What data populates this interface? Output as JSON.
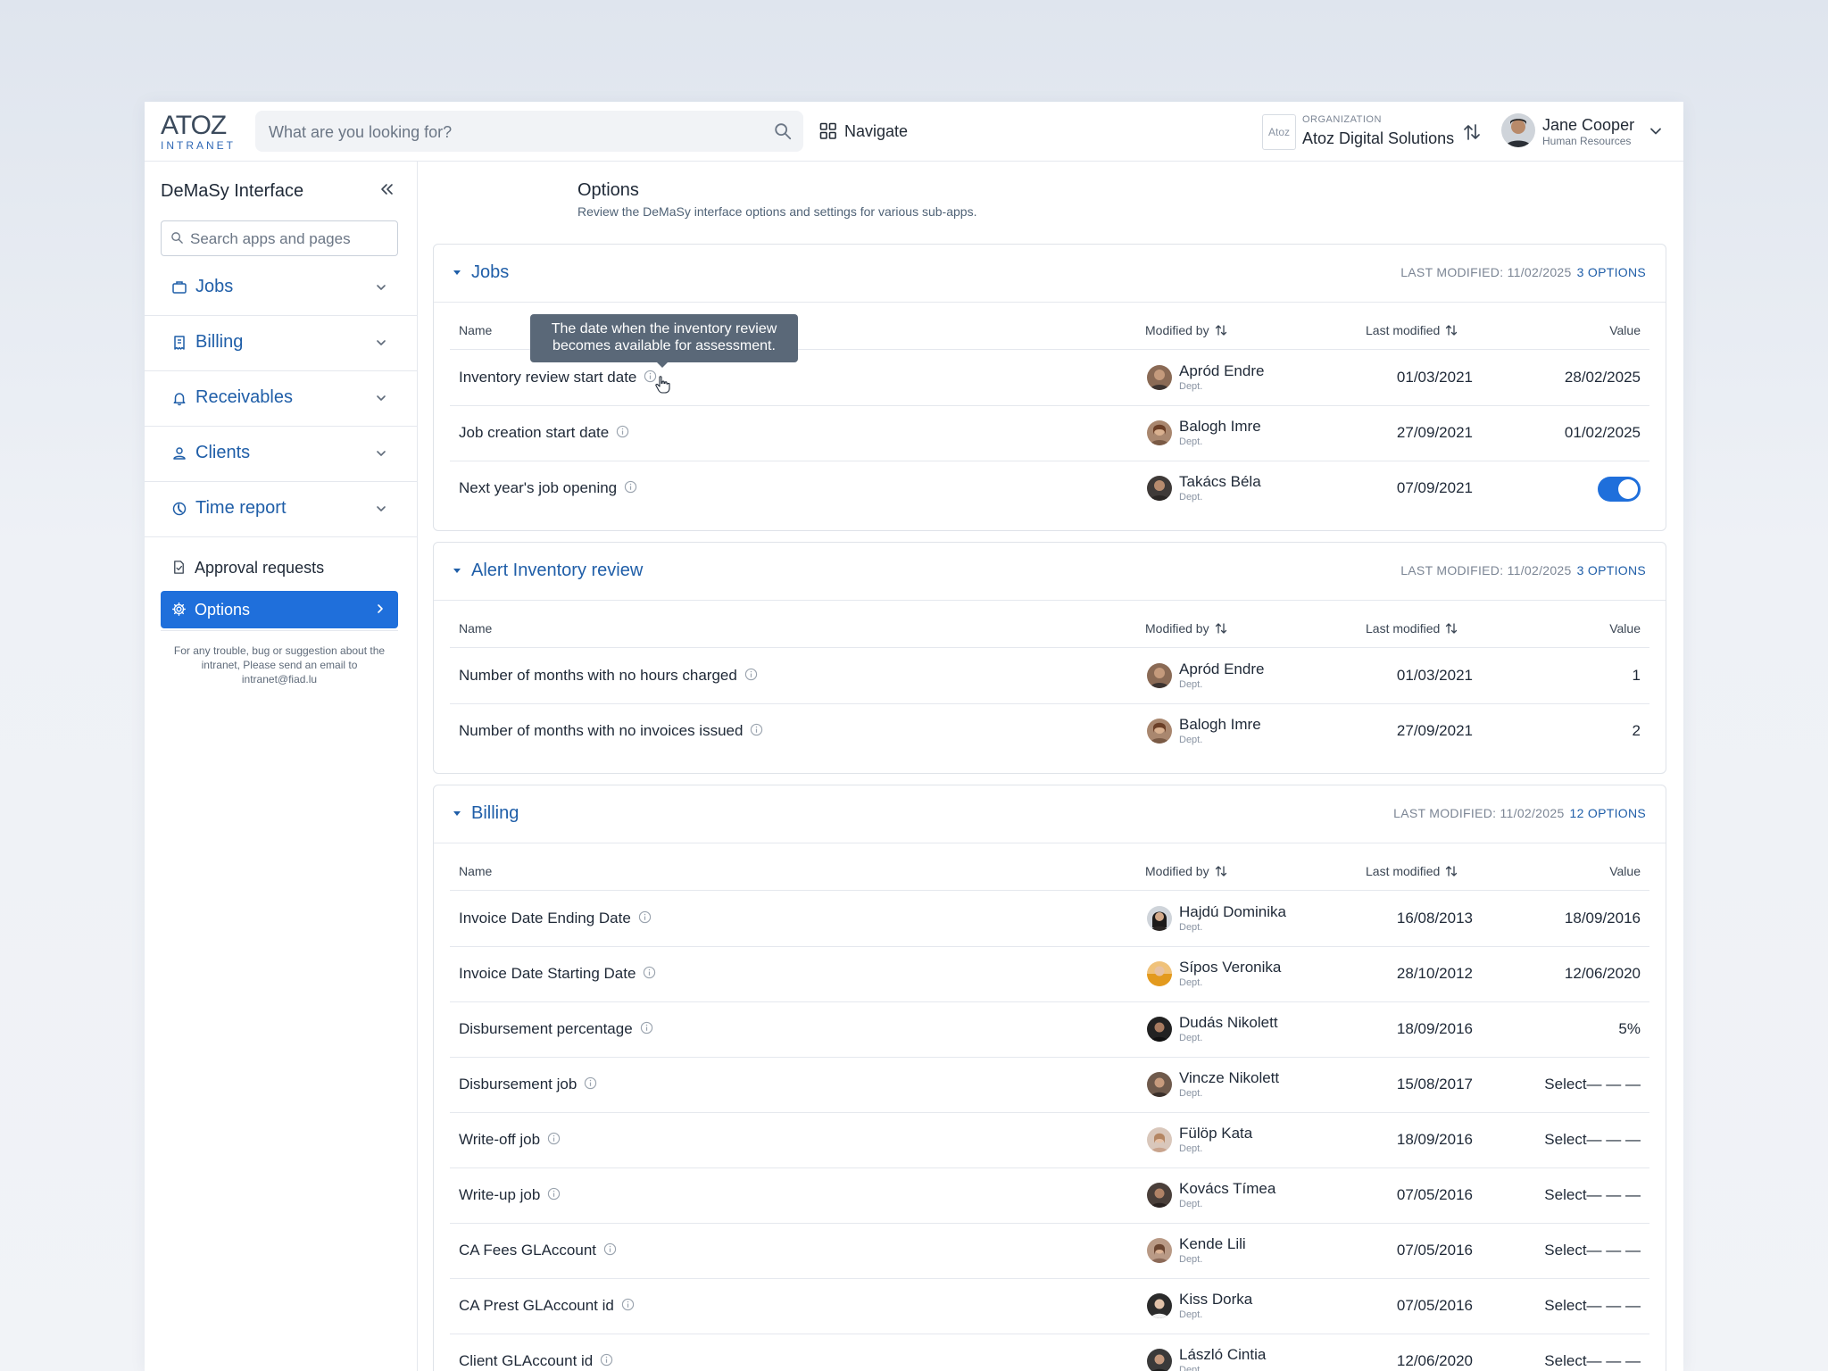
{
  "header": {
    "logo_main": "ATOZ",
    "logo_sub": "INTRANET",
    "search_placeholder": "What are you looking for?",
    "navigate_label": "Navigate",
    "org_logo_text": "Atoz",
    "org_label": "ORGANIZATION",
    "org_name": "Atoz Digital Solutions",
    "user_name": "Jane Cooper",
    "user_dept": "Human Resources"
  },
  "sidebar": {
    "title": "DeMaSy Interface",
    "search_placeholder": "Search apps and pages",
    "groups": [
      {
        "label": "Jobs",
        "icon": "briefcase-icon"
      },
      {
        "label": "Billing",
        "icon": "receipt-icon"
      },
      {
        "label": "Receivables",
        "icon": "bell-icon"
      },
      {
        "label": "Clients",
        "icon": "user-icon"
      },
      {
        "label": "Time report",
        "icon": "pie-chart-icon"
      }
    ],
    "items": [
      {
        "label": "Approval requests",
        "icon": "document-check-icon",
        "active": false
      },
      {
        "label": "Options",
        "icon": "gear-icon",
        "active": true
      }
    ],
    "footer": "For any trouble, bug or suggestion about the intranet, Please send an email to intranet@fiad.lu"
  },
  "page": {
    "title": "Options",
    "subtitle": "Review the DeMaSy interface options and settings for various sub-apps."
  },
  "columns": {
    "name": "Name",
    "modified_by": "Modified by",
    "last_modified": "Last modified",
    "value": "Value"
  },
  "dept_label": "Dept.",
  "tooltip": {
    "line1": "The date when the inventory review",
    "line2": "becomes available for assessment."
  },
  "sections": [
    {
      "title": "Jobs",
      "last_modified": "LAST MODIFIED: 11/02/2025",
      "count": "3 OPTIONS",
      "rows": [
        {
          "name": "Inventory review start date",
          "modified_by": "Apród Endre",
          "last_modified": "01/03/2021",
          "value": "28/02/2025"
        },
        {
          "name": "Job creation start date",
          "modified_by": "Balogh Imre",
          "last_modified": "27/09/2021",
          "value": "01/02/2025"
        },
        {
          "name": "Next year's job opening",
          "modified_by": "Takács Béla",
          "last_modified": "07/09/2021",
          "value": "",
          "toggle_on": true
        }
      ]
    },
    {
      "title": "Alert Inventory review",
      "last_modified": "LAST MODIFIED: 11/02/2025",
      "count": "3 OPTIONS",
      "rows": [
        {
          "name": "Number of months with no hours charged",
          "modified_by": "Apród Endre",
          "last_modified": "01/03/2021",
          "value": "1"
        },
        {
          "name": "Number of months with no invoices issued",
          "modified_by": "Balogh Imre",
          "last_modified": "27/09/2021",
          "value": "2"
        }
      ]
    },
    {
      "title": "Billing",
      "last_modified": "LAST MODIFIED: 11/02/2025",
      "count": "12 OPTIONS",
      "rows": [
        {
          "name": "Invoice Date Ending Date",
          "modified_by": "Hajdú Dominika",
          "last_modified": "16/08/2013",
          "value": "18/09/2016"
        },
        {
          "name": "Invoice Date Starting Date",
          "modified_by": "Sípos Veronika",
          "last_modified": "28/10/2012",
          "value": "12/06/2020"
        },
        {
          "name": "Disbursement percentage",
          "modified_by": "Dudás Nikolett",
          "last_modified": "18/09/2016",
          "value": "5%"
        },
        {
          "name": "Disbursement job",
          "modified_by": "Vincze Nikolett",
          "last_modified": "15/08/2017",
          "value": "Select— — —"
        },
        {
          "name": "Write-off job",
          "modified_by": "Fülöp Kata",
          "last_modified": "18/09/2016",
          "value": "Select— — —"
        },
        {
          "name": "Write-up job",
          "modified_by": "Kovács Tímea",
          "last_modified": "07/05/2016",
          "value": "Select— — —"
        },
        {
          "name": "CA Fees GLAccount",
          "modified_by": "Kende Lili",
          "last_modified": "07/05/2016",
          "value": "Select— — —"
        },
        {
          "name": "CA Prest GLAccount id",
          "modified_by": "Kiss Dorka",
          "last_modified": "07/05/2016",
          "value": "Select— — —"
        },
        {
          "name": "Client GLAccount id",
          "modified_by": "László Cintia",
          "last_modified": "12/06/2020",
          "value": "Select— — —"
        }
      ]
    }
  ],
  "colors": {
    "accent": "#1f6fdb",
    "link": "#1f5ea8",
    "tooltip_bg": "#5a6878"
  }
}
